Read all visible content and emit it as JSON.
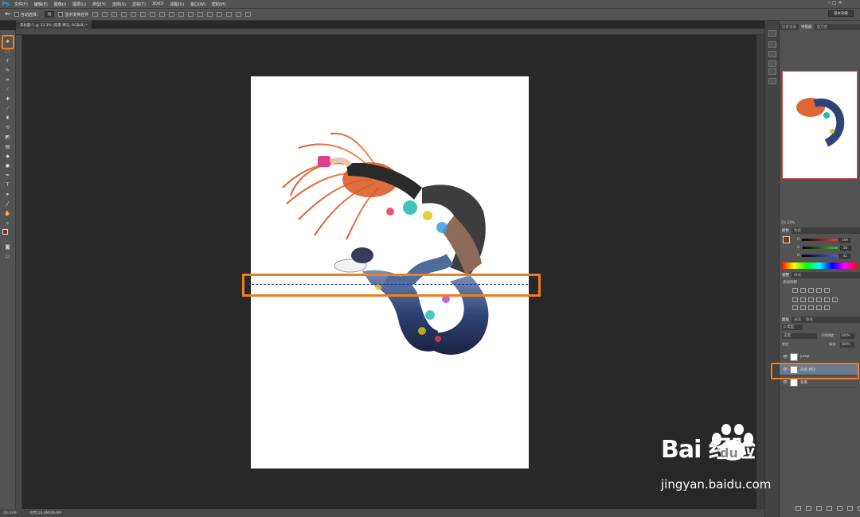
{
  "menubar": {
    "logo": "Ps",
    "items": [
      "文件(F)",
      "编辑(E)",
      "图像(I)",
      "图层(L)",
      "类型(Y)",
      "选择(S)",
      "滤镜(T)",
      "3D(D)",
      "视图(V)",
      "窗口(W)",
      "帮助(H)"
    ],
    "workspace": "基本功能",
    "window_controls": "– □ ✕"
  },
  "options": {
    "auto_select_label": "自动选择：",
    "auto_select_value": "组",
    "show_transform_label": "显示变换控件"
  },
  "document": {
    "tab_title": "未标题-1 @ 33.3% (背景 拷贝, RGB/8) *",
    "zoom": "33.33%",
    "doc_size": "文档:24.9M/49.9M"
  },
  "panels": {
    "top_tabs": [
      "历史记录",
      "导航器",
      "直方图"
    ],
    "nav_zoom": "33.33%",
    "color_tabs": [
      "颜色",
      "色板"
    ],
    "color_channels": [
      {
        "label": "R",
        "value": "109",
        "color": "#e04040"
      },
      {
        "label": "G",
        "value": "58",
        "color": "#40c040"
      },
      {
        "label": "B",
        "value": "41",
        "color": "#4060e0"
      }
    ],
    "adjust_tabs": [
      "调整",
      "样式"
    ],
    "adjust_title": "添加调整",
    "layer_tabs": [
      "图层",
      "通道",
      "路径"
    ],
    "layer_kind": "ρ 类型",
    "blend_mode": "正常",
    "opacity_label": "不透明度:",
    "opacity_value": "100%",
    "lock_label": "锁定:",
    "fill_label": "填充:",
    "fill_value": "100%",
    "layers": [
      {
        "name": "jump",
        "selected": false
      },
      {
        "name": "背景 拷贝",
        "selected": true
      },
      {
        "name": "背景",
        "selected": false
      }
    ]
  },
  "watermark": {
    "brand": "Bai 经验",
    "paw": "du",
    "url": "jingyan.baidu.com"
  },
  "colors": {
    "highlight": "#ef7d21",
    "selected_layer": "#6b7a8f",
    "foreground": "#6d3a29"
  }
}
